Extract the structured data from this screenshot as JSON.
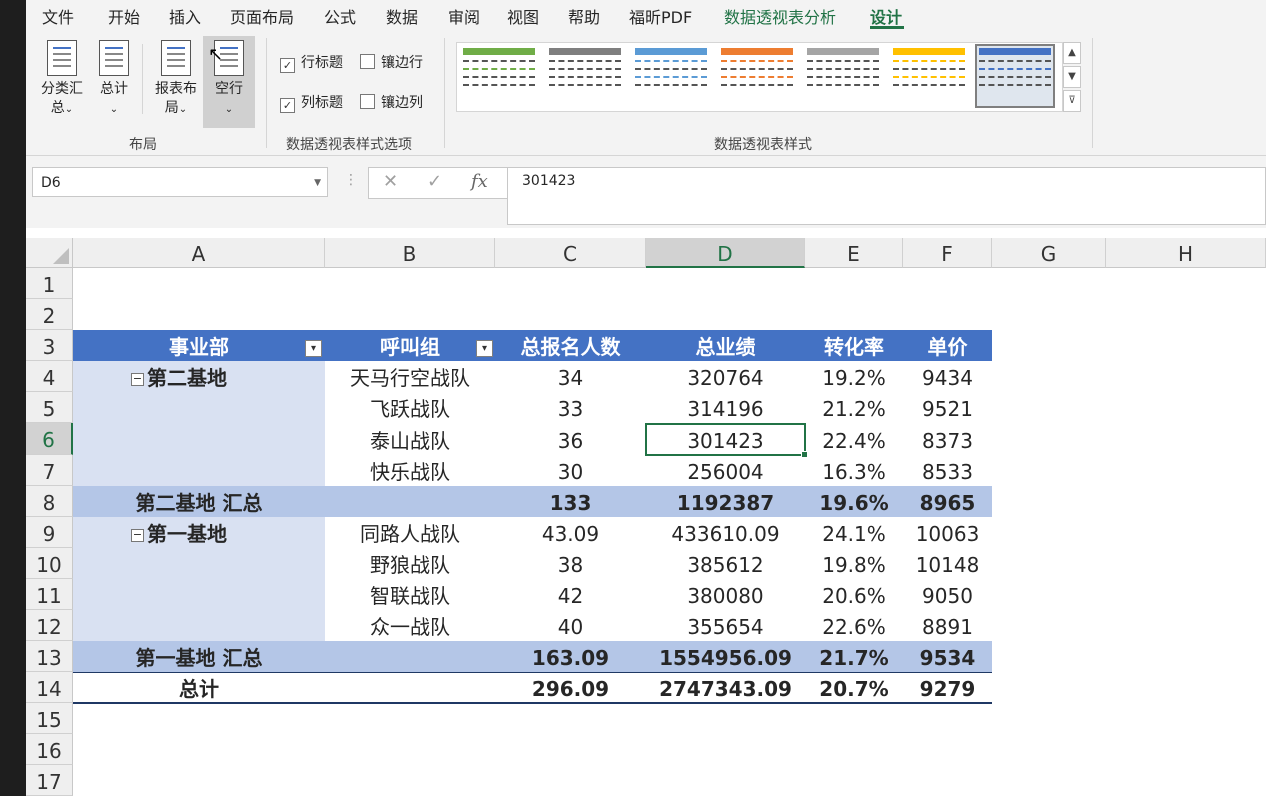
{
  "ribbon": {
    "tabs": [
      "文件",
      "开始",
      "插入",
      "页面布局",
      "公式",
      "数据",
      "审阅",
      "视图",
      "帮助",
      "福昕PDF",
      "数据透视表分析",
      "设计"
    ],
    "active_tab": "设计",
    "layout_group": {
      "label": "布局",
      "buttons": [
        {
          "line1": "分类汇",
          "line2": "总"
        },
        {
          "line1": "总计",
          "line2": ""
        },
        {
          "line1": "报表布",
          "line2": "局"
        },
        {
          "line1": "空行",
          "line2": ""
        }
      ]
    },
    "style_options": {
      "label": "数据透视表样式选项",
      "row_headers": "行标题",
      "col_headers": "列标题",
      "banded_rows": "镶边行",
      "banded_cols": "镶边列",
      "row_headers_checked": true,
      "col_headers_checked": true,
      "banded_rows_checked": false,
      "banded_cols_checked": false
    },
    "styles": {
      "label": "数据透视表样式",
      "swatches": [
        "#70ad47",
        "#7f7f7f",
        "#5b9bd5",
        "#ed7d31",
        "#a5a5a5",
        "#ffc000",
        "#4472c4"
      ],
      "selected_index": 6
    }
  },
  "formula_bar": {
    "name_box": "D6",
    "formula": "301423",
    "fx": "fx"
  },
  "columns": [
    "A",
    "B",
    "C",
    "D",
    "E",
    "F",
    "G",
    "H"
  ],
  "selected_column": "D",
  "rows": [
    "1",
    "2",
    "3",
    "4",
    "5",
    "6",
    "7",
    "8",
    "9",
    "10",
    "11",
    "12",
    "13",
    "14",
    "15",
    "16",
    "17"
  ],
  "selected_row": "6",
  "pivot": {
    "headers": [
      "事业部",
      "呼叫组",
      "总报名人数",
      "总业绩",
      "转化率",
      "单价"
    ],
    "groups": [
      {
        "name": "第二基地",
        "rows": [
          [
            "天马行空战队",
            "34",
            "320764",
            "19.2%",
            "9434"
          ],
          [
            "飞跃战队",
            "33",
            "314196",
            "21.2%",
            "9521"
          ],
          [
            "泰山战队",
            "36",
            "301423",
            "22.4%",
            "8373"
          ],
          [
            "快乐战队",
            "30",
            "256004",
            "16.3%",
            "8533"
          ]
        ],
        "subtotal": {
          "label": "第二基地 汇总",
          "count": "133",
          "amount": "1192387",
          "rate": "19.6%",
          "price": "8965"
        }
      },
      {
        "name": "第一基地",
        "rows": [
          [
            "同路人战队",
            "43.09",
            "433610.09",
            "24.1%",
            "10063"
          ],
          [
            "野狼战队",
            "38",
            "385612",
            "19.8%",
            "10148"
          ],
          [
            "智联战队",
            "42",
            "380080",
            "20.6%",
            "9050"
          ],
          [
            "众一战队",
            "40",
            "355654",
            "22.6%",
            "8891"
          ]
        ],
        "subtotal": {
          "label": "第一基地 汇总",
          "count": "163.09",
          "amount": "1554956.09",
          "rate": "21.7%",
          "price": "9534"
        }
      }
    ],
    "grand_total": {
      "label": "总计",
      "count": "296.09",
      "amount": "2747343.09",
      "rate": "20.7%",
      "price": "9279"
    }
  }
}
